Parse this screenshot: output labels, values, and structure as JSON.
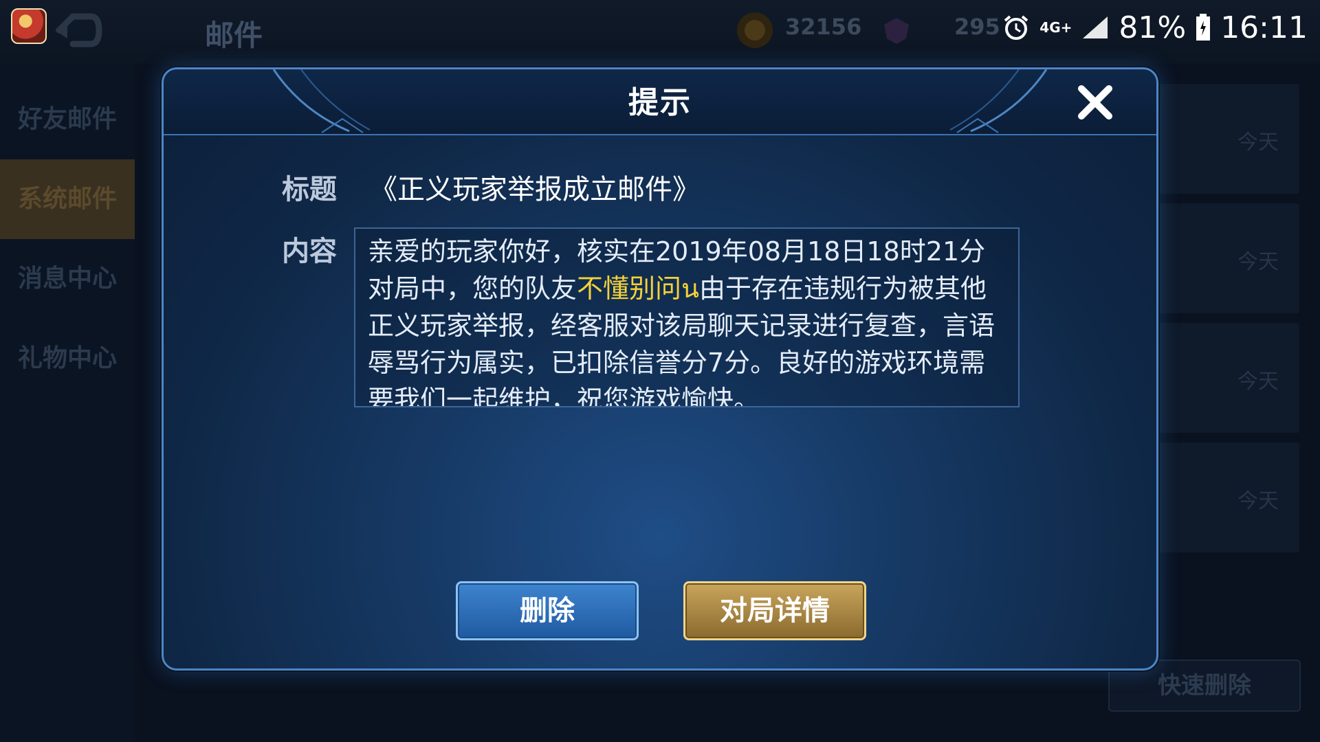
{
  "status_bar": {
    "network": "4G+",
    "battery": "81%",
    "time": "16:11"
  },
  "header": {
    "title": "邮件",
    "gold": "32156",
    "gems": "295"
  },
  "sidebar": {
    "items": [
      {
        "label": "好友邮件"
      },
      {
        "label": "系统邮件"
      },
      {
        "label": "消息中心"
      },
      {
        "label": "礼物中心"
      }
    ]
  },
  "mail_list": {
    "dates": [
      "今天",
      "今天",
      "今天",
      "今天"
    ],
    "quick_delete": "快速删除"
  },
  "dialog": {
    "title": "提示",
    "subject_label": "标题",
    "subject_value": "《正义玩家举报成立邮件》",
    "content_label": "内容",
    "content_before": "亲爱的玩家你好，核实在2019年08月18日18时21分对局中，您的队友",
    "content_highlight": "不懂别问น",
    "content_after": "由于存在违规行为被其他正义玩家举报，经客服对该局聊天记录进行复查，言语辱骂行为属实，已扣除信誉分7分。良好的游戏环境需要我们一起维护，祝您游戏愉快。",
    "delete_button": "删除",
    "details_button": "对局详情"
  },
  "colors": {
    "highlight": "#f5d23a",
    "dialog_border": "#4d86c4",
    "delete_button": "#2f74c0",
    "details_button": "#b08a45"
  }
}
